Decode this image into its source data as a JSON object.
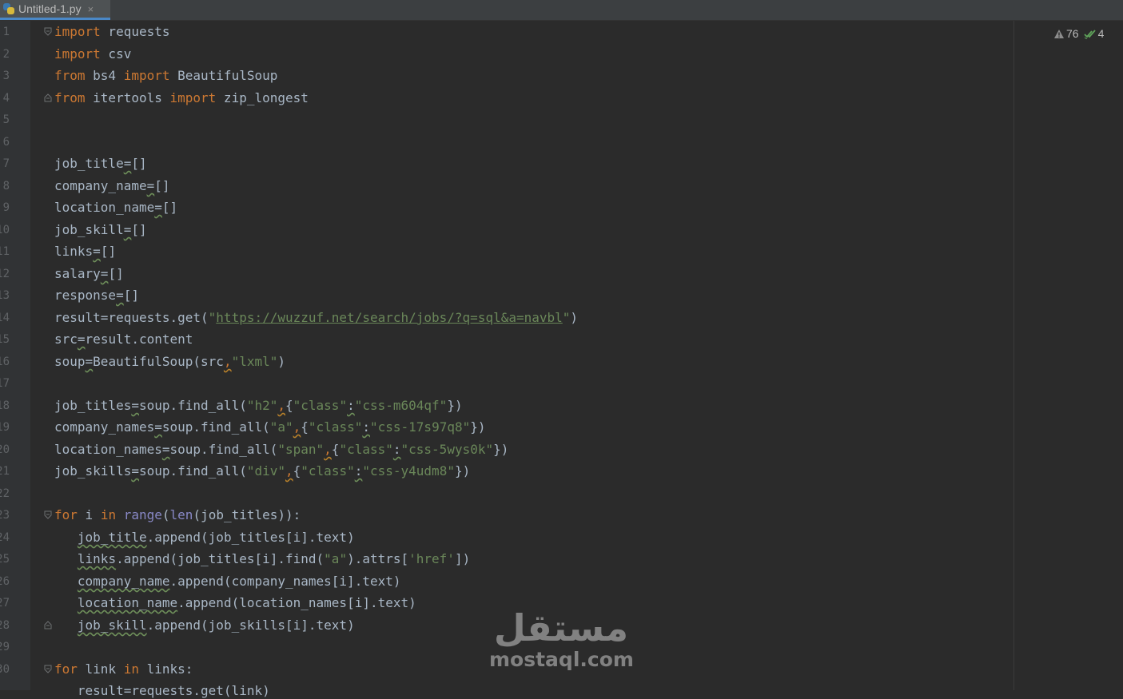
{
  "tab": {
    "filename": "Untitled-1.py",
    "close": "×"
  },
  "inspections": {
    "warnings": "76",
    "ok": "4"
  },
  "watermark": {
    "arabic": "مستقل",
    "latin": "mostaql.com"
  },
  "line_numbers": [
    "1",
    "2",
    "3",
    "4",
    "5",
    "6",
    "7",
    "8",
    "9",
    "10",
    "11",
    "12",
    "13",
    "14",
    "15",
    "16",
    "17",
    "18",
    "19",
    "20",
    "21",
    "22",
    "23",
    "24",
    "25",
    "26",
    "27",
    "28",
    "29",
    "30"
  ],
  "code": {
    "l1": [
      "import",
      " requests"
    ],
    "l2": [
      "import",
      " csv"
    ],
    "l3": [
      "from",
      " bs4 ",
      "import",
      " BeautifulSoup"
    ],
    "l4": [
      "from",
      " itertools ",
      "import",
      " zip_longest"
    ],
    "l7": [
      "job_title",
      "=",
      "[]"
    ],
    "l8": [
      "company_name",
      "=",
      "[]"
    ],
    "l9": [
      "location_name",
      "=",
      "[]"
    ],
    "l10": [
      "job_skill",
      "=",
      "[]"
    ],
    "l11": [
      "links",
      "=",
      "[]"
    ],
    "l12": [
      "salary",
      "=",
      "[]"
    ],
    "l13": [
      "response",
      "=",
      "[]"
    ],
    "l14": [
      "result=requests.get(",
      "\"",
      "https://wuzzuf.net/search/jobs/?q=sql&a=navbl",
      "\"",
      ")"
    ],
    "l15": [
      "src",
      "=",
      "result.content"
    ],
    "l16": [
      "soup",
      "=",
      "BeautifulSoup(src",
      ",",
      "\"lxml\"",
      ")"
    ],
    "l18": [
      "job_titles",
      "=",
      "soup.find_all(",
      "\"h2\"",
      ",",
      "{",
      "\"class\"",
      ":",
      "\"css-m604qf\"",
      "})"
    ],
    "l19": [
      "company_names",
      "=",
      "soup.find_all(",
      "\"a\"",
      ",",
      "{",
      "\"class\"",
      ":",
      "\"css-17s97q8\"",
      "})"
    ],
    "l20": [
      "location_names",
      "=",
      "soup.find_all(",
      "\"span\"",
      ",",
      "{",
      "\"class\"",
      ":",
      "\"css-5wys0k\"",
      "})"
    ],
    "l21": [
      "job_skills",
      "=",
      "soup.find_all(",
      "\"div\"",
      ",",
      "{",
      "\"class\"",
      ":",
      "\"css-y4udm8\"",
      "})"
    ],
    "l23": [
      "for",
      " i ",
      "in",
      " ",
      "range",
      "(",
      "len",
      "(job_titles)):"
    ],
    "l24": [
      "   ",
      "job_title",
      ".append(job_titles[i].text)"
    ],
    "l25": [
      "   ",
      "links",
      ".append(job_titles[i].find(",
      "\"a\"",
      ").attrs[",
      "'href'",
      "])"
    ],
    "l26": [
      "   ",
      "company_name",
      ".append(company_names[i].text)"
    ],
    "l27": [
      "   ",
      "location_name",
      ".append(location_names[i].text)"
    ],
    "l28": [
      "   ",
      "job_skill",
      ".append(job_skills[i].text)"
    ],
    "l30": [
      "for",
      " link ",
      "in",
      " links:"
    ],
    "l31": [
      "   result=requests.get(link)"
    ]
  }
}
